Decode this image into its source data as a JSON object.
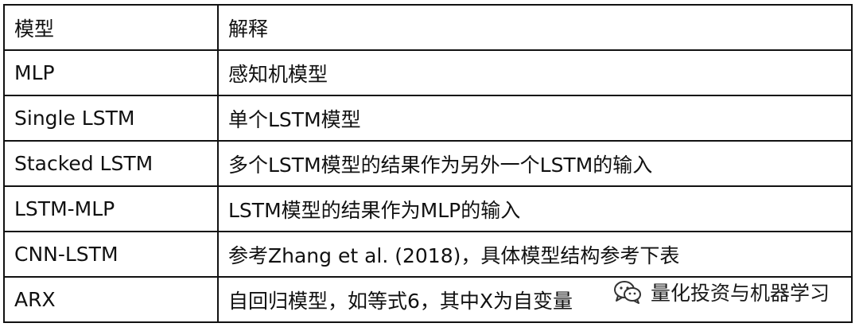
{
  "table": {
    "header": [
      "模型",
      "解释"
    ],
    "rows": [
      [
        "MLP",
        "感知机模型"
      ],
      [
        "Single LSTM",
        "单个LSTM模型"
      ],
      [
        "Stacked LSTM",
        "多个LSTM模型的结果作为另外一个LSTM的输入"
      ],
      [
        "LSTM-MLP",
        "LSTM模型的结果作为MLP的输入"
      ],
      [
        "CNN-LSTM",
        "参考Zhang et al. (2018)，具体模型结构参考下表"
      ],
      [
        "ARX",
        "自回归模型，如等式6，其中X为自变量"
      ]
    ]
  },
  "watermark": {
    "icon": "wechat-icon",
    "text": "量化投资与机器学习"
  }
}
